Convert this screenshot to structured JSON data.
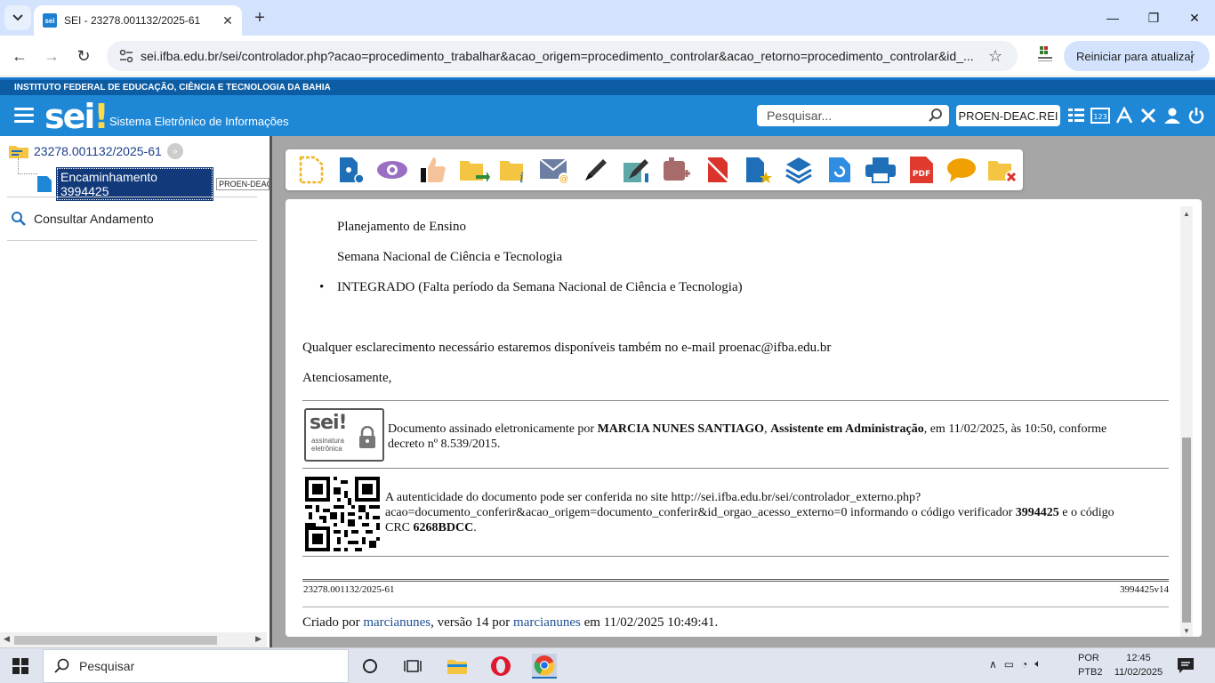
{
  "browser": {
    "tab_title": "SEI - 23278.001132/2025-61",
    "url": "sei.ifba.edu.br/sei/controlador.php?acao=procedimento_trabalhar&acao_origem=procedimento_controlar&acao_retorno=procedimento_controlar&id_...",
    "restart_label": "Reiniciar para atualizar"
  },
  "sei": {
    "institution": "INSTITUTO FEDERAL DE EDUCAÇÃO, CIÊNCIA E TECNOLOGIA DA BAHIA",
    "logo": "sei",
    "system_title": "Sistema Eletrônico de Informações",
    "search_placeholder": "Pesquisar...",
    "unit": "PROEN-DEAC.REI"
  },
  "tree": {
    "process_number": "23278.001132/2025-61",
    "document_label": "Encaminhamento 3994425",
    "document_unit": "PROEN-DEAC",
    "consult_label": "Consultar Andamento"
  },
  "document": {
    "line1": "Planejamento de Ensino",
    "line2": "Semana Nacional de Ciência e Tecnologia",
    "bullet": "INTEGRADO (Falta período da Semana Nacional de Ciência e Tecnologia)",
    "contact": "Qualquer esclarecimento necessário estaremos disponíveis também no e-mail proenac@ifba.edu.br",
    "closing": "Atenciosamente,",
    "sig_logo_text": "sei!",
    "sig_logo_sub1": "assinatura",
    "sig_logo_sub2": "eletrônica",
    "sig_prefix": "Documento assinado eletronicamente por ",
    "sig_name": "MARCIA NUNES SANTIAGO",
    "sig_sep": ", ",
    "sig_role": "Assistente em Administração",
    "sig_suffix": ", em 11/02/2025, às 10:50, conforme",
    "sig_line2": "decreto nº 8.539/2015.",
    "auth_line1": "A autenticidade do documento pode ser conferida no site http://sei.ifba.edu.br/sei/controlador_externo.php?",
    "auth_line2_prefix": "acao=documento_conferir&acao_origem=documento_conferir&id_orgao_acesso_externo=0 informando o código verificador ",
    "auth_code": "3994425",
    "auth_line2_suffix": " e o código",
    "auth_line3_prefix": "CRC ",
    "auth_crc": "6268BDCC",
    "auth_line3_suffix": ".",
    "footer_left": "23278.001132/2025-61",
    "footer_right": "3994425v14",
    "created_prefix": "Criado por ",
    "created_user": "marcianunes",
    "created_mid": ", versão 14 por ",
    "created_user2": "marcianunes",
    "created_suffix": " em 11/02/2025 10:49:41."
  },
  "taskbar": {
    "search_placeholder": "Pesquisar",
    "lang_line1": "POR",
    "lang_line2": "PTB2",
    "time": "12:45",
    "date": "11/02/2025"
  },
  "colors": {
    "sei_blue": "#1e88d7",
    "inst_blue": "#0d5da4",
    "link": "#1d4f96"
  }
}
